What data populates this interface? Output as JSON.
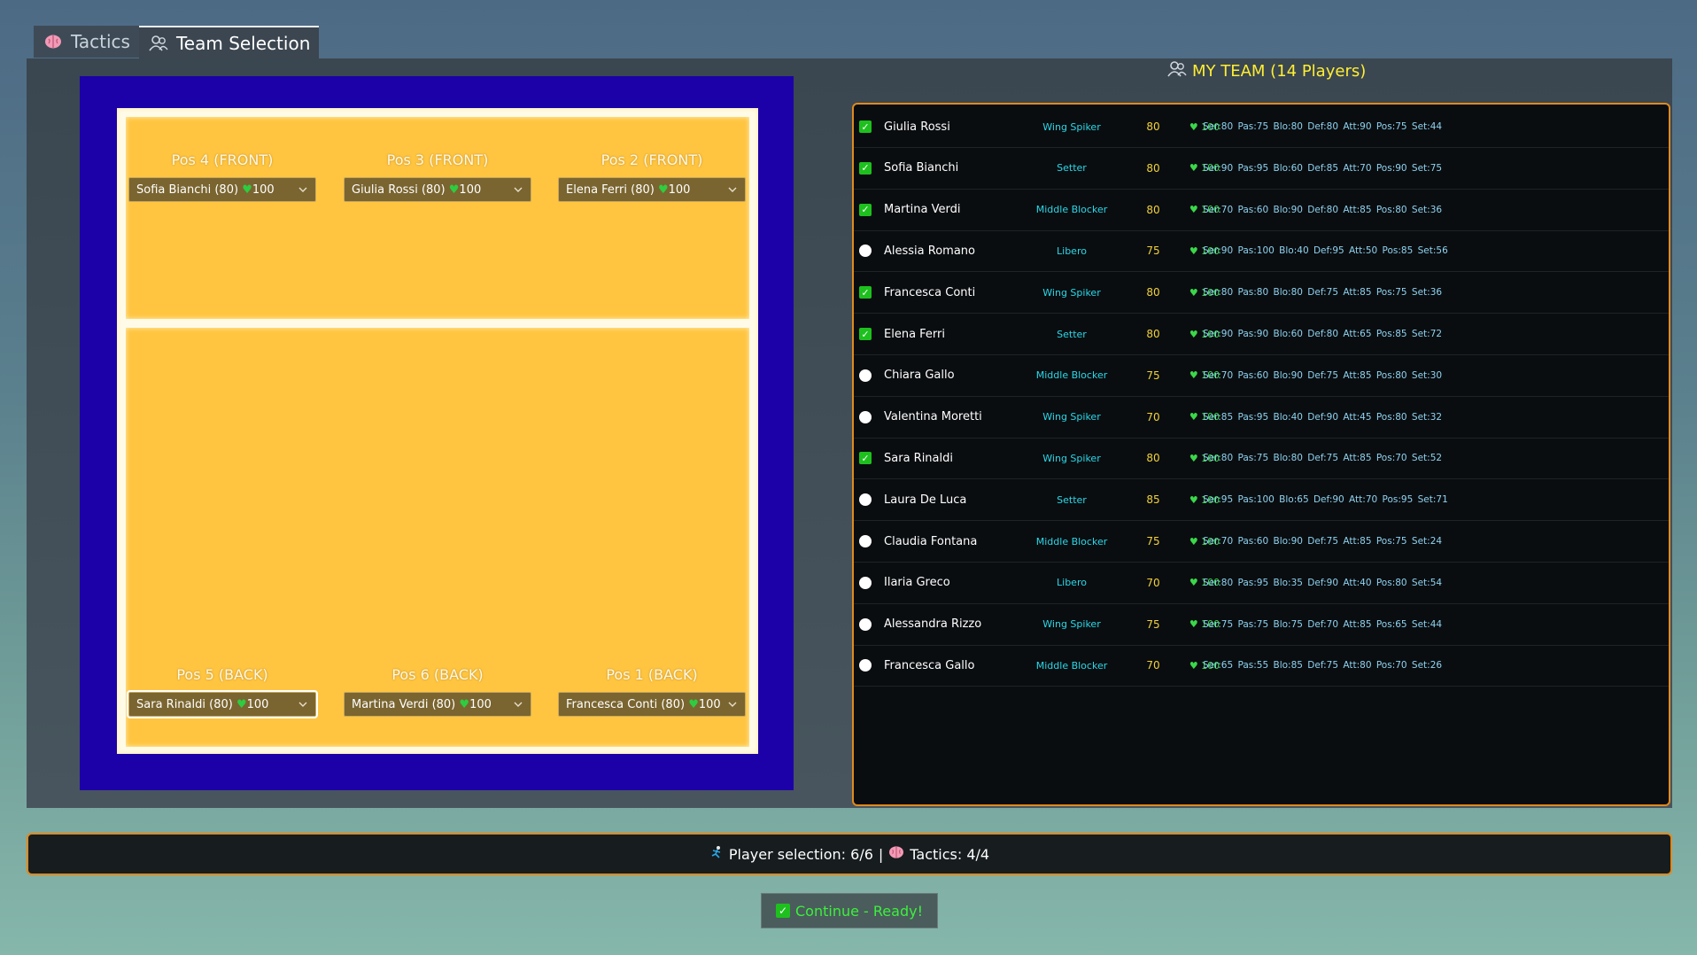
{
  "tabs": [
    {
      "icon": "brain-icon",
      "label": "Tactics",
      "active": false
    },
    {
      "icon": "players-icon",
      "label": "Team Selection",
      "active": true
    }
  ],
  "court": {
    "positions": [
      {
        "label": "Pos 4 (FRONT)",
        "player": "Sofia Bianchi (80)",
        "energy": "100"
      },
      {
        "label": "Pos 3 (FRONT)",
        "player": "Giulia Rossi (80)",
        "energy": "100"
      },
      {
        "label": "Pos 2 (FRONT)",
        "player": "Elena Ferri (80)",
        "energy": "100"
      },
      {
        "label": "Pos 5 (BACK)",
        "player": "Sara Rinaldi (80)",
        "energy": "100"
      },
      {
        "label": "Pos 6 (BACK)",
        "player": "Martina Verdi (80)",
        "energy": "100"
      },
      {
        "label": "Pos 1 (BACK)",
        "player": "Francesca Conti (80)",
        "energy": "100"
      }
    ]
  },
  "team": {
    "title": "MY TEAM (14 Players)",
    "players": [
      {
        "selected": true,
        "name": "Giulia Rossi",
        "role": "Wing Spiker",
        "rating": "80",
        "energy": "100",
        "stats": "Ser:80 Pas:75 Blo:80 Def:80 Att:90 Pos:75 Set:44"
      },
      {
        "selected": true,
        "name": "Sofia Bianchi",
        "role": "Setter",
        "rating": "80",
        "energy": "100",
        "stats": "Ser:90 Pas:95 Blo:60 Def:85 Att:70 Pos:90 Set:75"
      },
      {
        "selected": true,
        "name": "Martina Verdi",
        "role": "Middle Blocker",
        "rating": "80",
        "energy": "100",
        "stats": "Ser:70 Pas:60 Blo:90 Def:80 Att:85 Pos:80 Set:36"
      },
      {
        "selected": false,
        "name": "Alessia Romano",
        "role": "Libero",
        "rating": "75",
        "energy": "100",
        "stats": "Ser:90 Pas:100 Blo:40 Def:95 Att:50 Pos:85 Set:56"
      },
      {
        "selected": true,
        "name": "Francesca Conti",
        "role": "Wing Spiker",
        "rating": "80",
        "energy": "100",
        "stats": "Ser:80 Pas:80 Blo:80 Def:75 Att:85 Pos:75 Set:36"
      },
      {
        "selected": true,
        "name": "Elena Ferri",
        "role": "Setter",
        "rating": "80",
        "energy": "100",
        "stats": "Ser:90 Pas:90 Blo:60 Def:80 Att:65 Pos:85 Set:72"
      },
      {
        "selected": false,
        "name": "Chiara Gallo",
        "role": "Middle Blocker",
        "rating": "75",
        "energy": "100",
        "stats": "Ser:70 Pas:60 Blo:90 Def:75 Att:85 Pos:80 Set:30"
      },
      {
        "selected": false,
        "name": "Valentina Moretti",
        "role": "Wing Spiker",
        "rating": "70",
        "energy": "100",
        "stats": "Ser:85 Pas:95 Blo:40 Def:90 Att:45 Pos:80 Set:32"
      },
      {
        "selected": true,
        "name": "Sara Rinaldi",
        "role": "Wing Spiker",
        "rating": "80",
        "energy": "100",
        "stats": "Ser:80 Pas:75 Blo:80 Def:75 Att:85 Pos:70 Set:52"
      },
      {
        "selected": false,
        "name": "Laura De Luca",
        "role": "Setter",
        "rating": "85",
        "energy": "100",
        "stats": "Ser:95 Pas:100 Blo:65 Def:90 Att:70 Pos:95 Set:71"
      },
      {
        "selected": false,
        "name": "Claudia Fontana",
        "role": "Middle Blocker",
        "rating": "75",
        "energy": "100",
        "stats": "Ser:70 Pas:60 Blo:90 Def:75 Att:85 Pos:75 Set:24"
      },
      {
        "selected": false,
        "name": "Ilaria Greco",
        "role": "Libero",
        "rating": "70",
        "energy": "100",
        "stats": "Ser:80 Pas:95 Blo:35 Def:90 Att:40 Pos:80 Set:54"
      },
      {
        "selected": false,
        "name": "Alessandra Rizzo",
        "role": "Wing Spiker",
        "rating": "75",
        "energy": "100",
        "stats": "Ser:75 Pas:75 Blo:75 Def:70 Att:85 Pos:65 Set:44"
      },
      {
        "selected": false,
        "name": "Francesca Gallo",
        "role": "Middle Blocker",
        "rating": "70",
        "energy": "100",
        "stats": "Ser:65 Pas:55 Blo:85 Def:75 Att:80 Pos:70 Set:26"
      }
    ]
  },
  "status": {
    "selection_text": "Player selection: 6/6",
    "separator": "|",
    "tactics_text": "Tactics: 4/4"
  },
  "continue_label": "Continue - Ready!",
  "colors": {
    "court_outer": "#1c00a8",
    "court_floor": "#ffc540",
    "accent_border": "#e08a1e",
    "title_yellow": "#ffee33",
    "role_cyan": "#29d8e8",
    "energy_green": "#3ad84a"
  }
}
